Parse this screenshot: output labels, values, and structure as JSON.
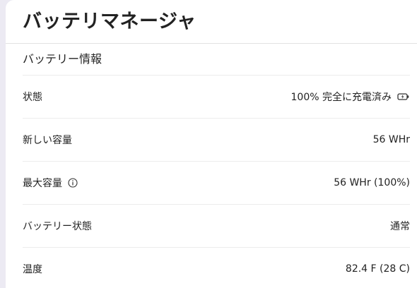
{
  "window": {
    "title": "バッテリマネージャ"
  },
  "battery_info": {
    "header": "バッテリー情報",
    "rows": [
      {
        "label": "状態",
        "value": "100% 完全に充電済み"
      },
      {
        "label": "新しい容量",
        "value": "56 WHr"
      },
      {
        "label": "最大容量",
        "value": "56 WHr (100%)"
      },
      {
        "label": "バッテリー状態",
        "value": "通常"
      },
      {
        "label": "温度",
        "value": "82.4 F (28 C)"
      }
    ]
  },
  "icons": {
    "info": "info-circle-icon",
    "charging": "battery-charging-icon"
  }
}
